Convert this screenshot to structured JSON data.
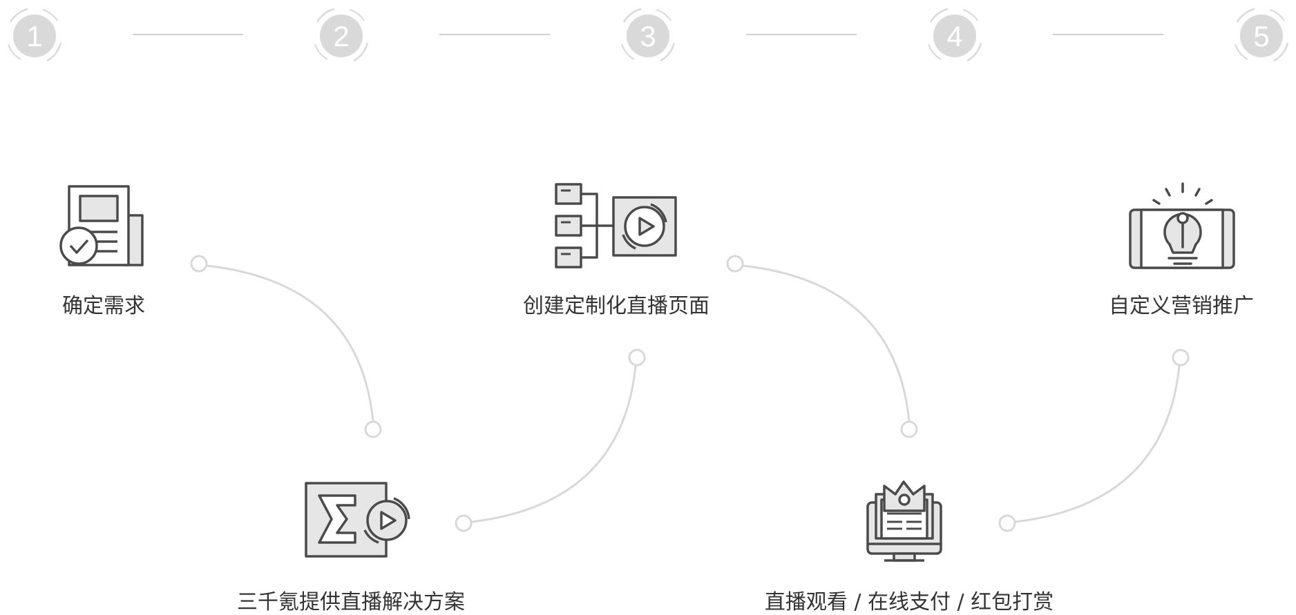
{
  "colors": {
    "circle": "#d9d9d9",
    "ring": "#d9d9d9",
    "connector": "#d8d8d8",
    "icon_stroke": "#4a4a4a",
    "icon_fill": "#e6e6e6",
    "text": "#333333"
  },
  "steps": [
    {
      "number": "1",
      "label": "确定需求",
      "icon": "newspaper-check-icon"
    },
    {
      "number": "2",
      "label": "三千氪提供直播解决方案",
      "icon": "sigma-play-icon"
    },
    {
      "number": "3",
      "label": "创建定制化直播页面",
      "icon": "flowchart-play-icon"
    },
    {
      "number": "4",
      "label": "直播观看 / 在线支付 / 红包打赏",
      "icon": "monitor-crown-icon"
    },
    {
      "number": "5",
      "label": "自定义营销推广",
      "icon": "tablet-lightbulb-icon"
    }
  ]
}
